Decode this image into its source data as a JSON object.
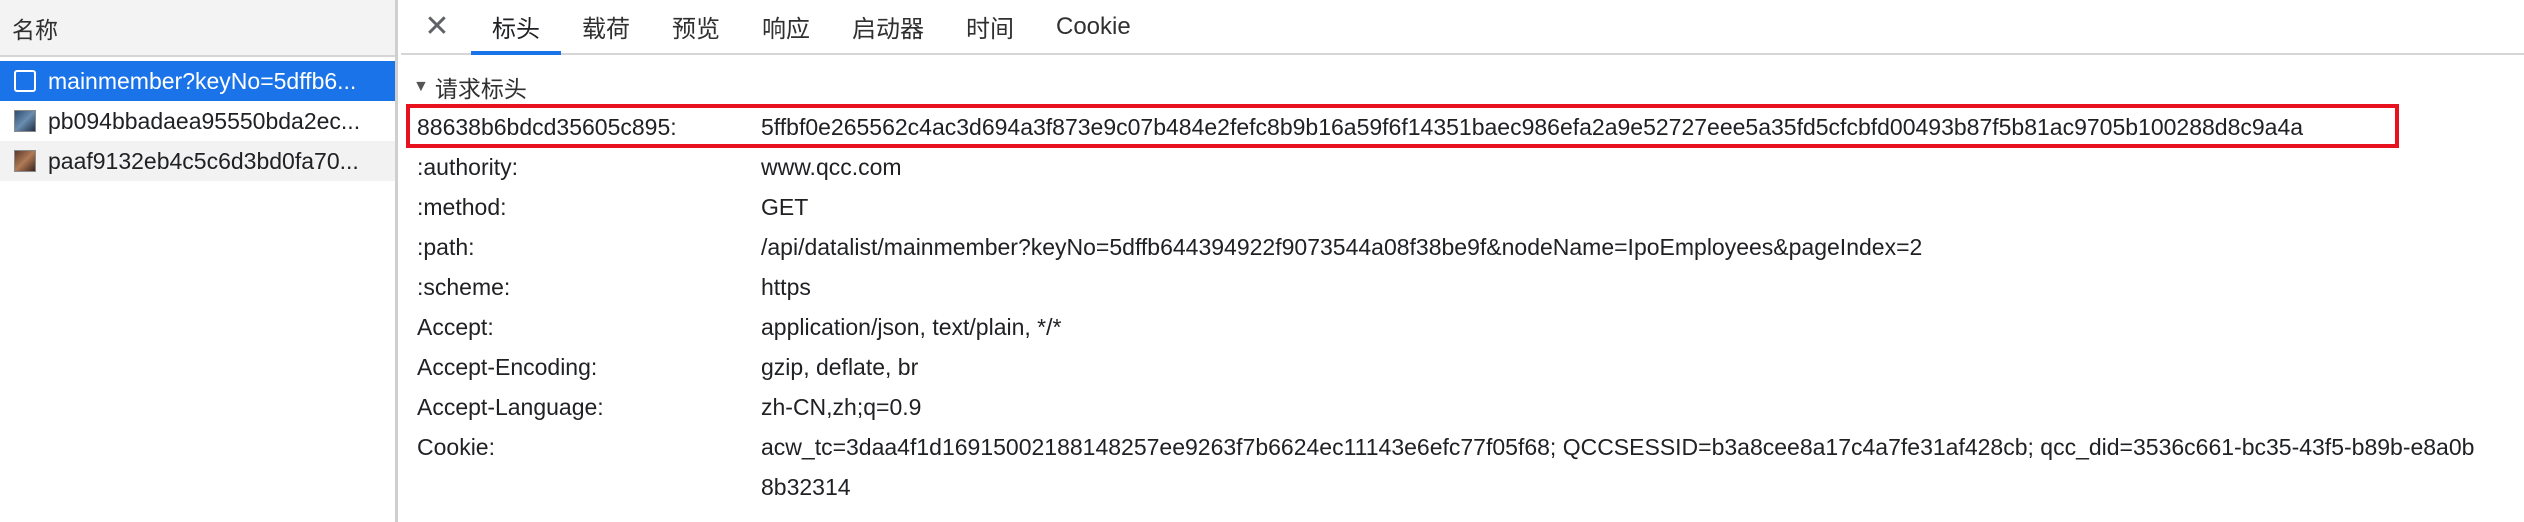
{
  "list": {
    "header": "名称",
    "items": [
      {
        "name": "mainmember?keyNo=5dffb6...",
        "icon": "document-icon"
      },
      {
        "name": "pb094bbadaea95550bda2ec...",
        "icon": "image-icon"
      },
      {
        "name": "paaf9132eb4c5c6d3bd0fa70...",
        "icon": "image-icon"
      }
    ]
  },
  "tabs": [
    "标头",
    "载荷",
    "预览",
    "响应",
    "启动器",
    "时间",
    "Cookie"
  ],
  "active_tab": "标头",
  "section": {
    "title": "请求标头"
  },
  "headers": [
    {
      "name": "88638b6bdcd35605c895:",
      "value": "5ffbf0e265562c4ac3d694a3f873e9c07b484e2fefc8b9b16a59f6f14351baec986efa2a9e52727eee5a35fd5cfcbfd00493b87f5b81ac9705b100288d8c9a4a"
    },
    {
      "name": ":authority:",
      "value": "www.qcc.com"
    },
    {
      "name": ":method:",
      "value": "GET"
    },
    {
      "name": ":path:",
      "value": "/api/datalist/mainmember?keyNo=5dffb644394922f9073544a08f38be9f&nodeName=IpoEmployees&pageIndex=2"
    },
    {
      "name": ":scheme:",
      "value": "https"
    },
    {
      "name": "Accept:",
      "value": "application/json, text/plain, */*"
    },
    {
      "name": "Accept-Encoding:",
      "value": "gzip, deflate, br"
    },
    {
      "name": "Accept-Language:",
      "value": "zh-CN,zh;q=0.9"
    },
    {
      "name": "Cookie:",
      "value": "acw_tc=3daa4f1d16915002188148257ee9263f7b6624ec11143e6efc77f05f68; QCCSESSID=b3a8cee8a17c4a7fe31af428cb; qcc_did=3536c661-bc35-43f5-b89b-e8a0b8b32314"
    }
  ],
  "colors": {
    "accent": "#1a73e8",
    "highlight_border": "#e8121e"
  }
}
